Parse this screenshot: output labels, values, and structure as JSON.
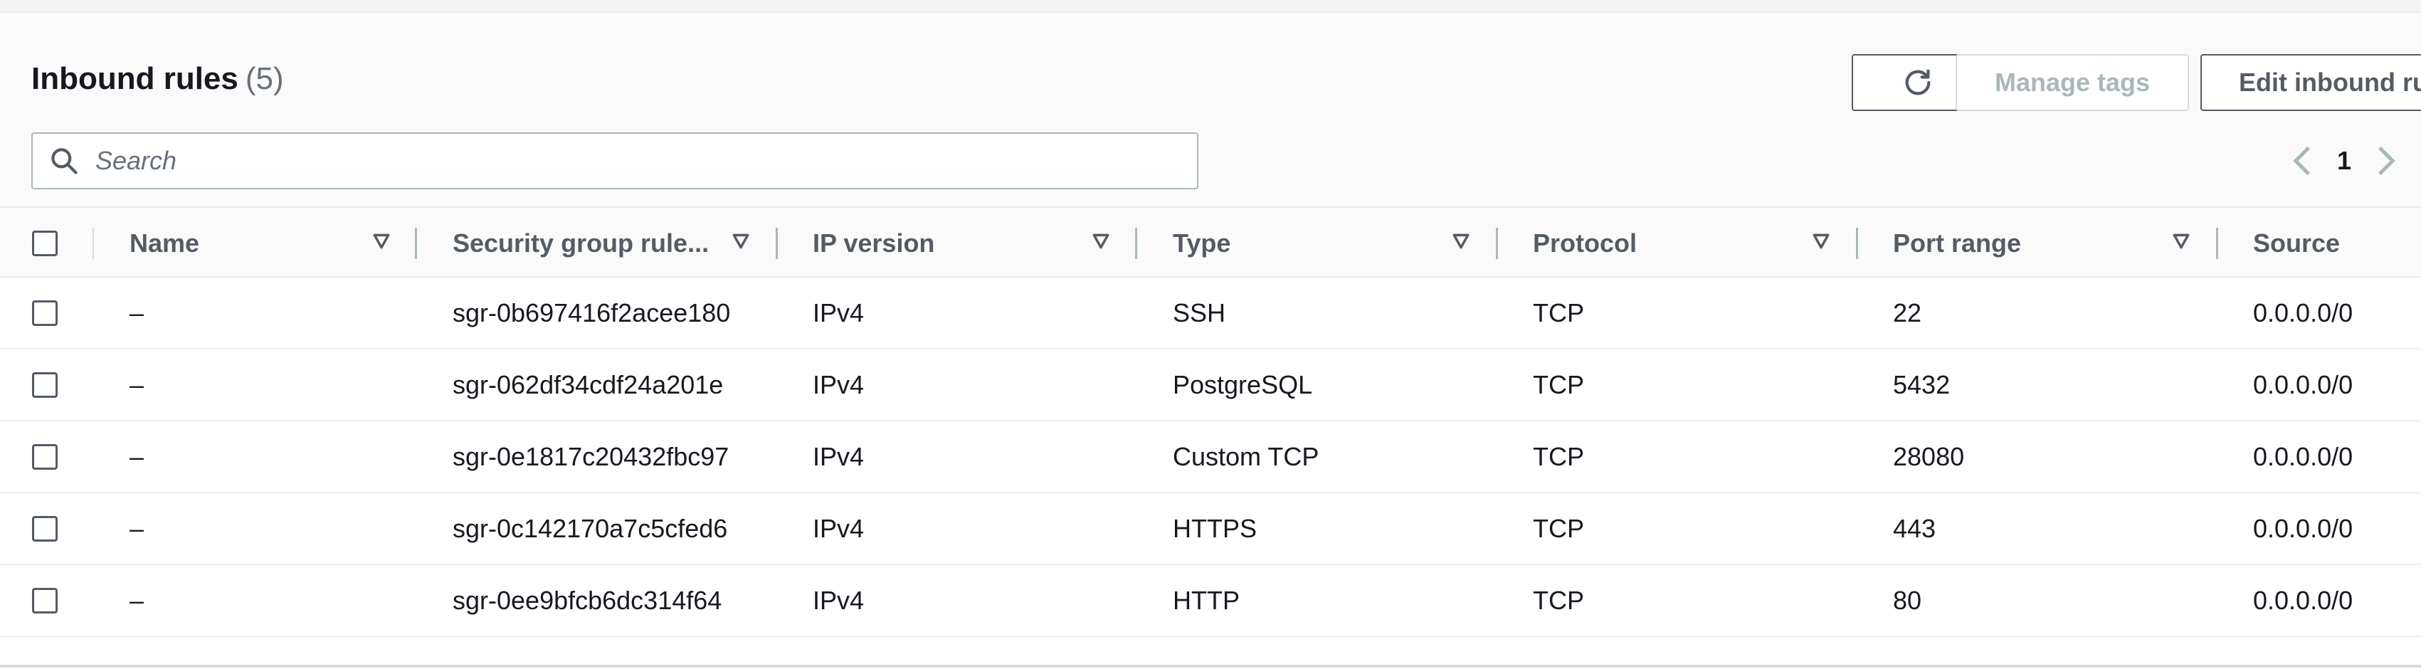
{
  "panel": {
    "title": "Inbound rules",
    "count": "(5)",
    "buttons": {
      "refresh_icon": "refresh-icon",
      "manage_tags": "Manage tags",
      "edit_inbound": "Edit inbound ru"
    },
    "search": {
      "placeholder": "Search",
      "icon": "search-icon"
    },
    "pagination": {
      "current_page": "1",
      "prev_icon": "chevron-left-icon",
      "next_icon": "chevron-right-icon"
    }
  },
  "table": {
    "columns": [
      {
        "label": "Name"
      },
      {
        "label": "Security group rule..."
      },
      {
        "label": "IP version"
      },
      {
        "label": "Type"
      },
      {
        "label": "Protocol"
      },
      {
        "label": "Port range"
      },
      {
        "label": "Source"
      }
    ],
    "rows": [
      {
        "name": "–",
        "rule_id": "sgr-0b697416f2acee180",
        "ip_version": "IPv4",
        "type": "SSH",
        "protocol": "TCP",
        "port_range": "22",
        "source": "0.0.0.0/0"
      },
      {
        "name": "–",
        "rule_id": "sgr-062df34cdf24a201e",
        "ip_version": "IPv4",
        "type": "PostgreSQL",
        "protocol": "TCP",
        "port_range": "5432",
        "source": "0.0.0.0/0"
      },
      {
        "name": "–",
        "rule_id": "sgr-0e1817c20432fbc97",
        "ip_version": "IPv4",
        "type": "Custom TCP",
        "protocol": "TCP",
        "port_range": "28080",
        "source": "0.0.0.0/0"
      },
      {
        "name": "–",
        "rule_id": "sgr-0c142170a7c5cfed6",
        "ip_version": "IPv4",
        "type": "HTTPS",
        "protocol": "TCP",
        "port_range": "443",
        "source": "0.0.0.0/0"
      },
      {
        "name": "–",
        "rule_id": "sgr-0ee9bfcb6dc314f64",
        "ip_version": "IPv4",
        "type": "HTTP",
        "protocol": "TCP",
        "port_range": "80",
        "source": "0.0.0.0/0"
      }
    ]
  },
  "colors": {
    "text": "#16191f",
    "muted": "#687078",
    "header_text": "#545b64",
    "border": "#aab7b8",
    "disabled": "#aab7b8",
    "background": "#fafafa"
  }
}
